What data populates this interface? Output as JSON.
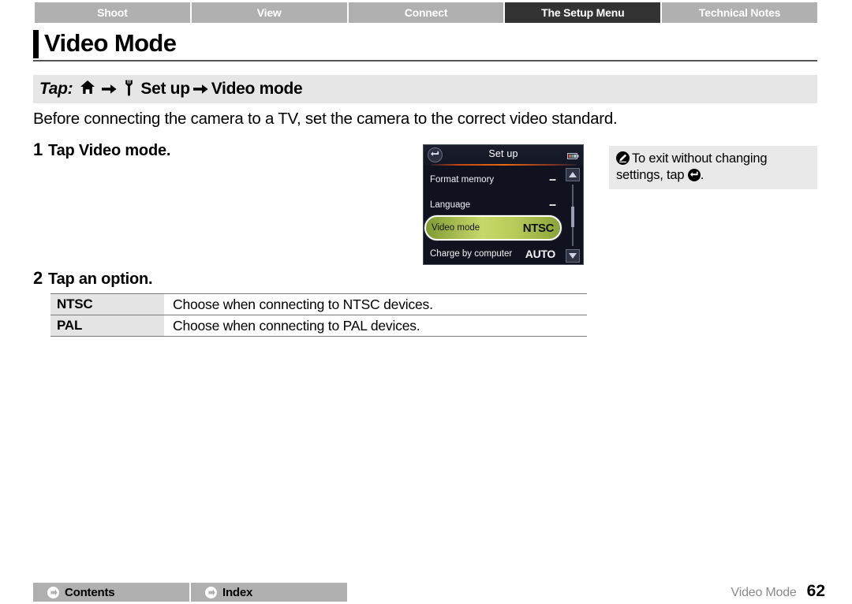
{
  "tabs": [
    {
      "label": "Shoot",
      "active": false
    },
    {
      "label": "View",
      "active": false
    },
    {
      "label": "Connect",
      "active": false
    },
    {
      "label": "The Setup Menu",
      "active": true
    },
    {
      "label": "Technical Notes",
      "active": false
    }
  ],
  "page": {
    "title": "Video Mode",
    "breadcrumb": {
      "tap_label": "Tap:",
      "home_icon": "home-icon",
      "arrow_icon": "arrow-right-icon",
      "wrench_icon": "wrench-icon",
      "menu_name": "Set up",
      "item_name": "Video mode"
    },
    "intro": "Before connecting the camera to a TV, set the camera to the correct video standard."
  },
  "steps": [
    {
      "number": "1",
      "text": "Tap ",
      "bold": "Video mode."
    },
    {
      "number": "2",
      "text": "Tap an option.",
      "bold": ""
    }
  ],
  "lcd": {
    "title": "Set up",
    "back_icon": "back-arrow-icon",
    "battery_icon": "battery-icon",
    "rows": [
      {
        "label": "Format memory",
        "value": "--",
        "selected": false
      },
      {
        "label": "Language",
        "value": "--",
        "selected": false
      },
      {
        "label": "Video mode",
        "value": "NTSC",
        "selected": true
      },
      {
        "label": "Charge by computer",
        "value": "AUTO",
        "selected": false
      }
    ],
    "scroll_up_icon": "scroll-up-icon",
    "scroll_down_icon": "scroll-down-icon"
  },
  "note": {
    "icon": "note-pencil-icon",
    "text_before": "To exit without changing settings, tap ",
    "inline_icon": "back-arrow-icon",
    "text_after": "."
  },
  "options_table": {
    "rows": [
      {
        "key": "NTSC",
        "description": "Choose when connecting to NTSC devices."
      },
      {
        "key": "PAL",
        "description": "Choose when connecting to PAL devices."
      }
    ]
  },
  "footer": {
    "buttons": [
      {
        "label": "Contents",
        "icon": "arrow-circle-right-icon"
      },
      {
        "label": "Index",
        "icon": "arrow-circle-right-icon"
      }
    ],
    "chapter": "Video Mode",
    "page_number": "62"
  },
  "colors": {
    "tab_inactive": "#b0b0b0",
    "tab_active": "#333333",
    "banner_bg": "#e6e6e6",
    "note_bg": "#e9e9e9",
    "lcd_bg": "#10131f",
    "lcd_highlight": "#b9cc5a",
    "lcd_accent": "#e86a10",
    "table_key_bg": "#e4e4e4"
  }
}
